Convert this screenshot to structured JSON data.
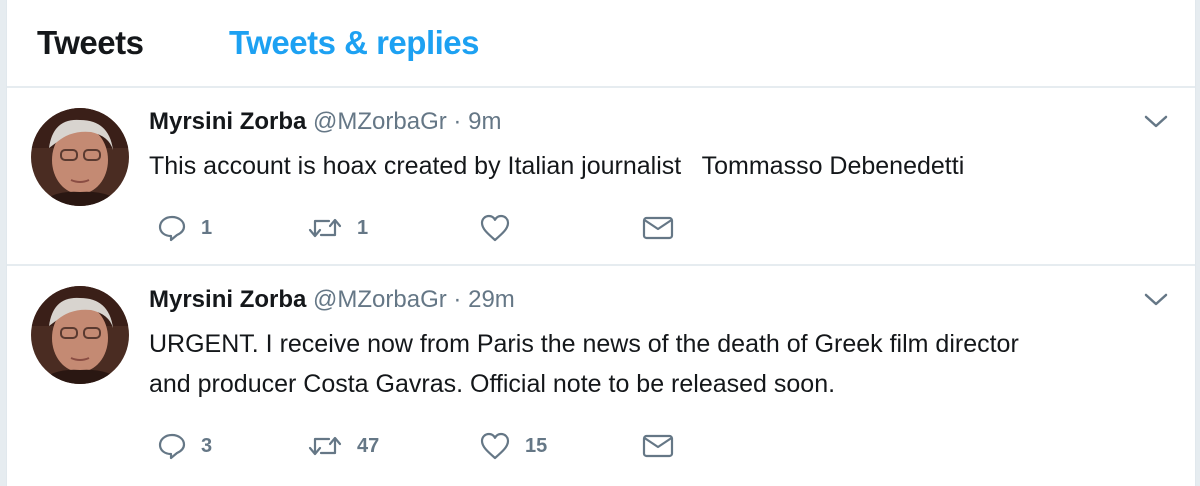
{
  "tabs": {
    "tweets": "Tweets",
    "replies": "Tweets & replies"
  },
  "colors": {
    "accent": "#1da1f2",
    "text": "#14171a",
    "muted": "#657786",
    "divider": "#e6ecf0"
  },
  "tweets": [
    {
      "name": "Myrsini Zorba",
      "handle": "@MZorbaGr",
      "separator": "·",
      "time": "9m",
      "text_lines": [
        "This account is hoax created by Italian journalist   Tommasso Debenedetti"
      ],
      "replies": "1",
      "retweets": "1",
      "likes": ""
    },
    {
      "name": "Myrsini Zorba",
      "handle": "@MZorbaGr",
      "separator": "·",
      "time": "29m",
      "text_lines": [
        "URGENT. I receive now from Paris the news of the death of Greek film director",
        "and producer Costa Gavras. Official note to be released soon."
      ],
      "replies": "3",
      "retweets": "47",
      "likes": "15"
    }
  ],
  "icons": {
    "avatar": "avatar",
    "more": "chevron-down-icon",
    "reply": "reply-icon",
    "retweet": "retweet-icon",
    "like": "heart-icon",
    "message": "envelope-icon"
  }
}
